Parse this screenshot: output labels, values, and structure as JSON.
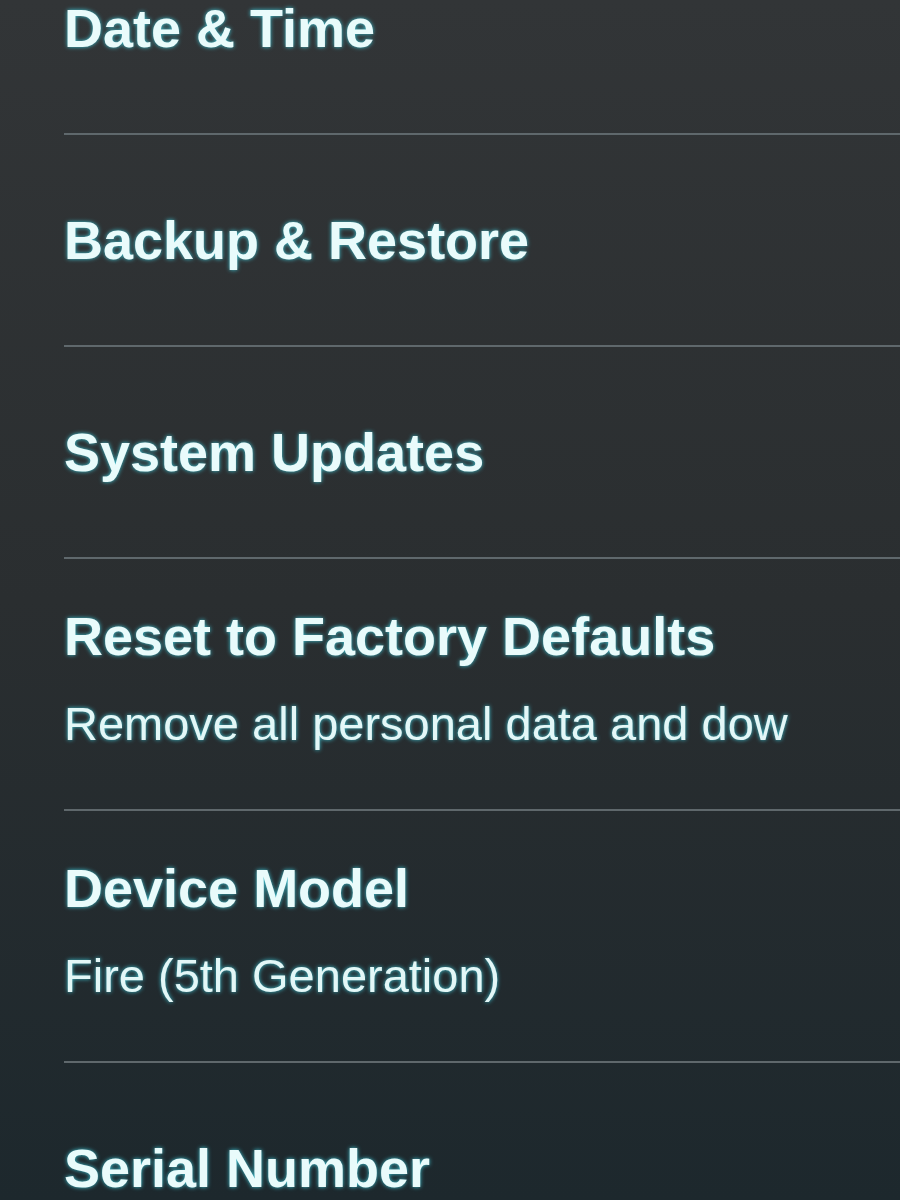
{
  "settings": [
    {
      "title": "Date & Time"
    },
    {
      "title": "Backup & Restore"
    },
    {
      "title": "System Updates"
    },
    {
      "title": "Reset to Factory Defaults",
      "description": "Remove all personal data and dow"
    },
    {
      "title": "Device Model",
      "value": "Fire (5th Generation)"
    },
    {
      "title": "Serial Number"
    }
  ]
}
